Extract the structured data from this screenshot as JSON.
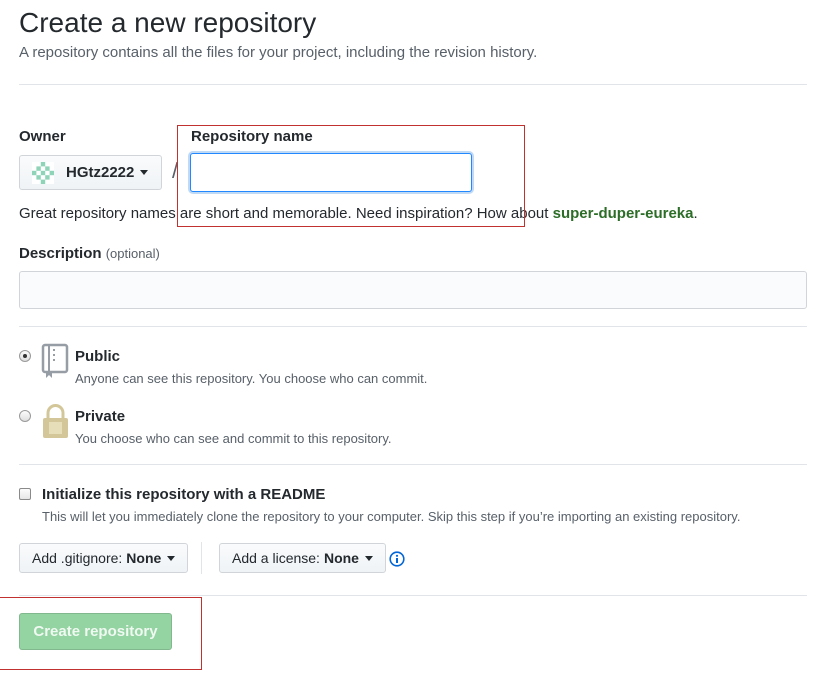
{
  "header": {
    "title": "Create a new repository",
    "subtitle": "A repository contains all the files for your project, including the revision history."
  },
  "owner": {
    "label": "Owner",
    "value": "HGtz2222",
    "avatar_icon": "identicon-avatar"
  },
  "separator": "/",
  "repo_name": {
    "label": "Repository name",
    "value": "",
    "placeholder": ""
  },
  "hint": {
    "prefix": "Great repository names are short and memorable. Need inspiration? How about ",
    "suggestion": "super-duper-eureka",
    "suffix": "."
  },
  "description": {
    "label": "Description",
    "optional": "(optional)",
    "value": "",
    "placeholder": ""
  },
  "visibility": {
    "public": {
      "title": "Public",
      "desc": "Anyone can see this repository. You choose who can commit.",
      "selected": true,
      "icon": "repo-book-icon"
    },
    "private": {
      "title": "Private",
      "desc": "You choose who can see and commit to this repository.",
      "selected": false,
      "icon": "lock-icon"
    }
  },
  "init": {
    "title": "Initialize this repository with a README",
    "desc": "This will let you immediately clone the repository to your computer. Skip this step if you’re importing an existing repository.",
    "checked": false
  },
  "gitignore": {
    "label": "Add .gitignore:",
    "value": "None"
  },
  "license": {
    "label": "Add a license:",
    "value": "None"
  },
  "create_button": "Create repository",
  "colors": {
    "accent_blue": "#2188ff",
    "suggestion_green": "#2c6e27",
    "button_green_disabled": "#94d3a2",
    "annotation_red": "#c0312f"
  }
}
